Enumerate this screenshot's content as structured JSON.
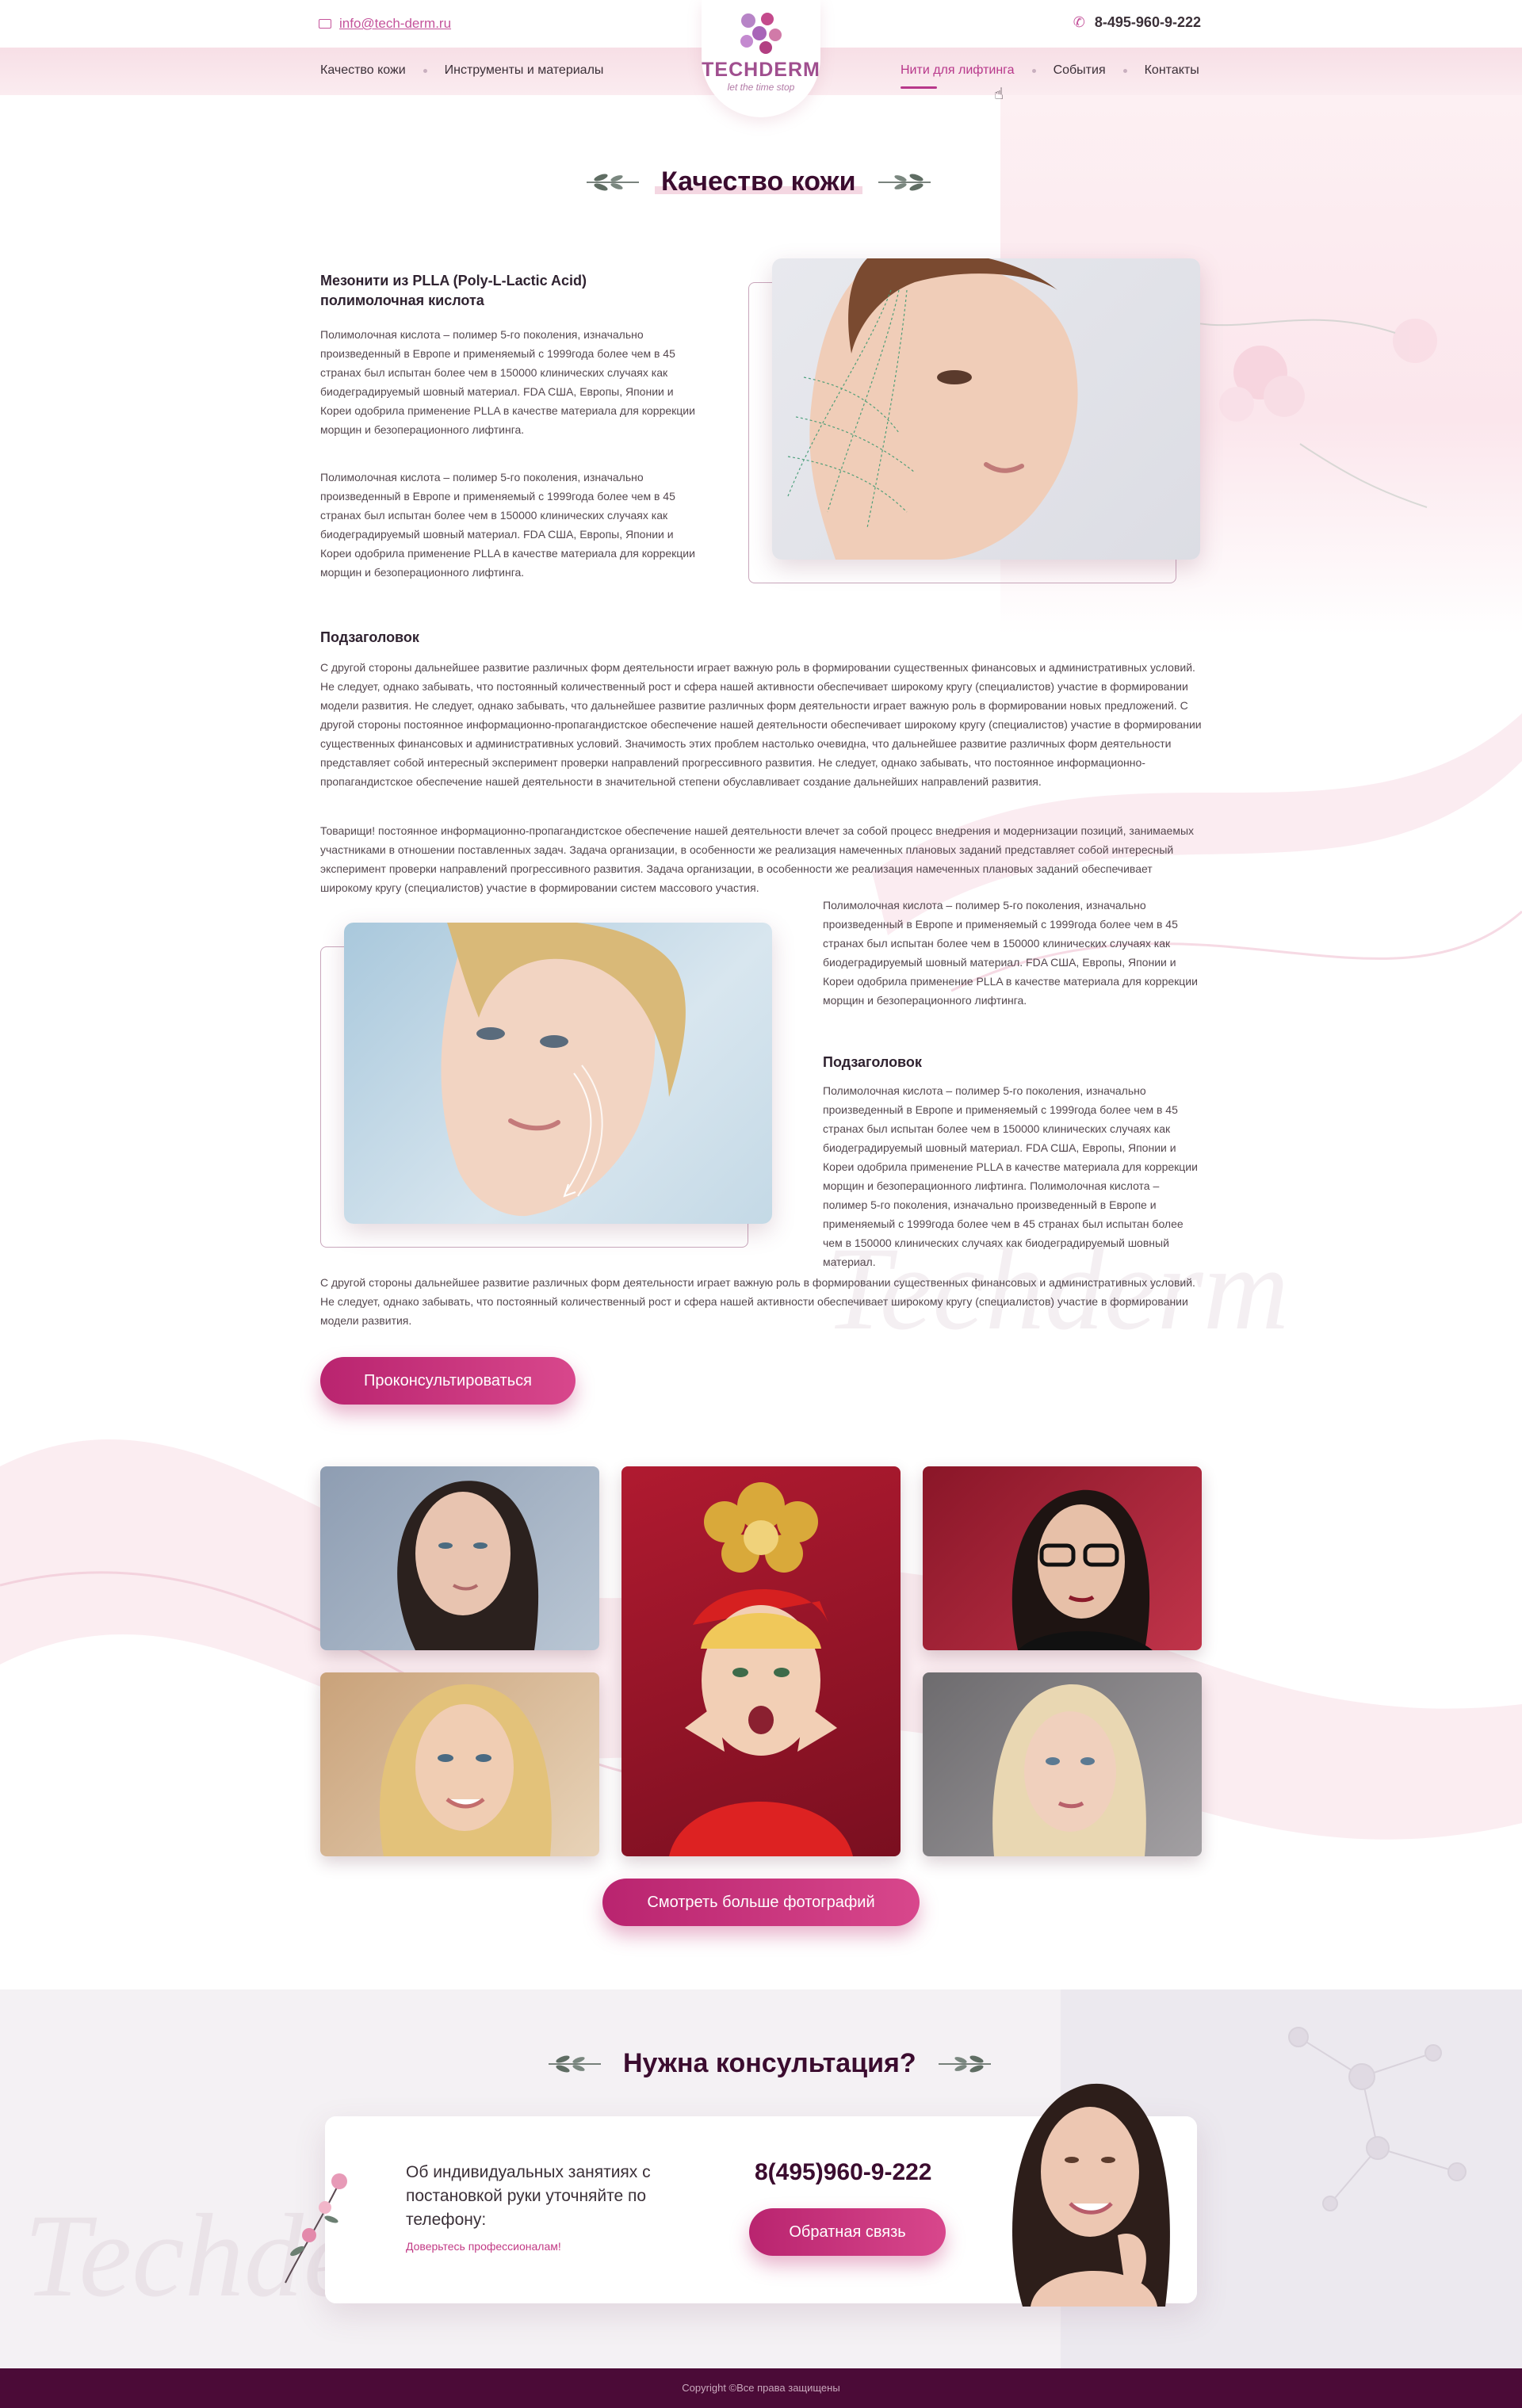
{
  "header": {
    "email": "info@tech-derm.ru",
    "phone": "8-495-960-9-222",
    "logo": {
      "name": "TECHDERM",
      "tagline": "let the time stop"
    },
    "nav_left": [
      "Качество кожи",
      "Инструменты и материалы"
    ],
    "nav_right": [
      "Нити для лифтинга",
      "События",
      "Контакты"
    ],
    "active_nav": "Нити для лифтинга"
  },
  "page_title": "Качество кожи",
  "article": {
    "heading1": "Мезонити из PLLA (Poly-L-Lactic Acid) полимолочная кислота",
    "p1": "Полимолочная кислота – полимер 5-го поколения, изначально произведенный в Европе и применяемый с 1999года более чем в 45 странах был испытан более чем в 150000 клинических случаях как биодеградируемый шовный материал. FDA США, Европы, Японии и Кореи одобрила применение PLLA в качестве материала для коррекции морщин и безоперационного лифтинга.",
    "p2": "Полимолочная кислота – полимер 5-го поколения, изначально произведенный в Европе и применяемый с 1999года более чем в 45 странах был испытан более чем в 150000 клинических случаях как биодеградируемый шовный материал. FDA США, Европы, Японии и Кореи одобрила применение PLLA в качестве материала для коррекции морщин и безоперационного лифтинга.",
    "heading2": "Подзаголовок",
    "p3": "С другой стороны дальнейшее развитие различных форм деятельности играет важную роль в формировании существенных финансовых и административных условий. Не следует, однако забывать, что постоянный количественный рост и сфера нашей активности обеспечивает широкому кругу (специалистов) участие в формировании модели развития. Не следует, однако забывать, что дальнейшее развитие различных форм деятельности играет важную роль в формировании новых предложений. С другой стороны постоянное информационно-пропагандистское обеспечение нашей деятельности обеспечивает широкому кругу (специалистов) участие в формировании существенных финансовых и административных условий. Значимость этих проблем настолько очевидна, что дальнейшее развитие различных форм деятельности представляет собой интересный эксперимент проверки направлений прогрессивного развития. Не следует, однако забывать, что постоянное информационно-пропагандистское обеспечение нашей деятельности в значительной степени обуславливает создание дальнейших направлений развития.",
    "p4": "Товарищи! постоянное информационно-пропагандистское обеспечение нашей деятельности влечет за собой процесс внедрения и модернизации позиций, занимаемых участниками в отношении поставленных задач. Задача организации, в особенности же реализация намеченных плановых заданий представляет собой интересный эксперимент проверки направлений прогрессивного развития. Задача организации, в особенности же реализация намеченных плановых заданий обеспечивает широкому кругу (специалистов) участие в формировании систем массового участия.",
    "p5": "Полимолочная кислота – полимер 5-го поколения, изначально произведенный в Европе и применяемый с 1999года более чем в 45 странах был испытан более чем в 150000 клинических случаях как биодеградируемый шовный материал. FDA США, Европы, Японии и Кореи одобрила применение PLLA в качестве материала для коррекции морщин и безоперационного лифтинга.",
    "heading3": "Подзаголовок",
    "p6": "Полимолочная кислота – полимер 5-го поколения, изначально произведенный в Европе и применяемый с 1999года более чем в 45 странах был испытан более чем в 150000 клинических случаях как биодеградируемый шовный материал. FDA США, Европы, Японии и Кореи одобрила применение PLLA в качестве материала для коррекции морщин и безоперационного лифтинга. Полимолочная кислота – полимер 5-го поколения, изначально произведенный в Европе и применяемый с 1999года более чем в 45 странах был испытан более чем в 150000 клинических случаях как биодеградируемый шовный материал.",
    "p7": "С другой стороны дальнейшее развитие различных форм деятельности играет важную роль в формировании существенных финансовых и административных условий. Не следует, однако забывать, что постоянный количественный рост и сфера нашей активности обеспечивает широкому кругу (специалистов) участие в формировании модели развития.",
    "cta": "Проконсультироваться"
  },
  "gallery": {
    "more_button": "Смотреть больше фотографий"
  },
  "consult": {
    "title": "Нужна консультация?",
    "text": "Об индивидуальных занятиях с постановкой руки уточняйте по телефону:",
    "note": "Доверьтесь профессионалам!",
    "phone": "8(495)960-9-222",
    "button": "Обратная связь"
  },
  "watermark": "Techderm",
  "footer": {
    "copyright": "Copyright ©Все права защищены"
  },
  "colors": {
    "accent": "#b8388b",
    "dark": "#3b0c2f",
    "footer": "#4b0b37",
    "button_from": "#b9246f",
    "button_to": "#d8478c"
  }
}
